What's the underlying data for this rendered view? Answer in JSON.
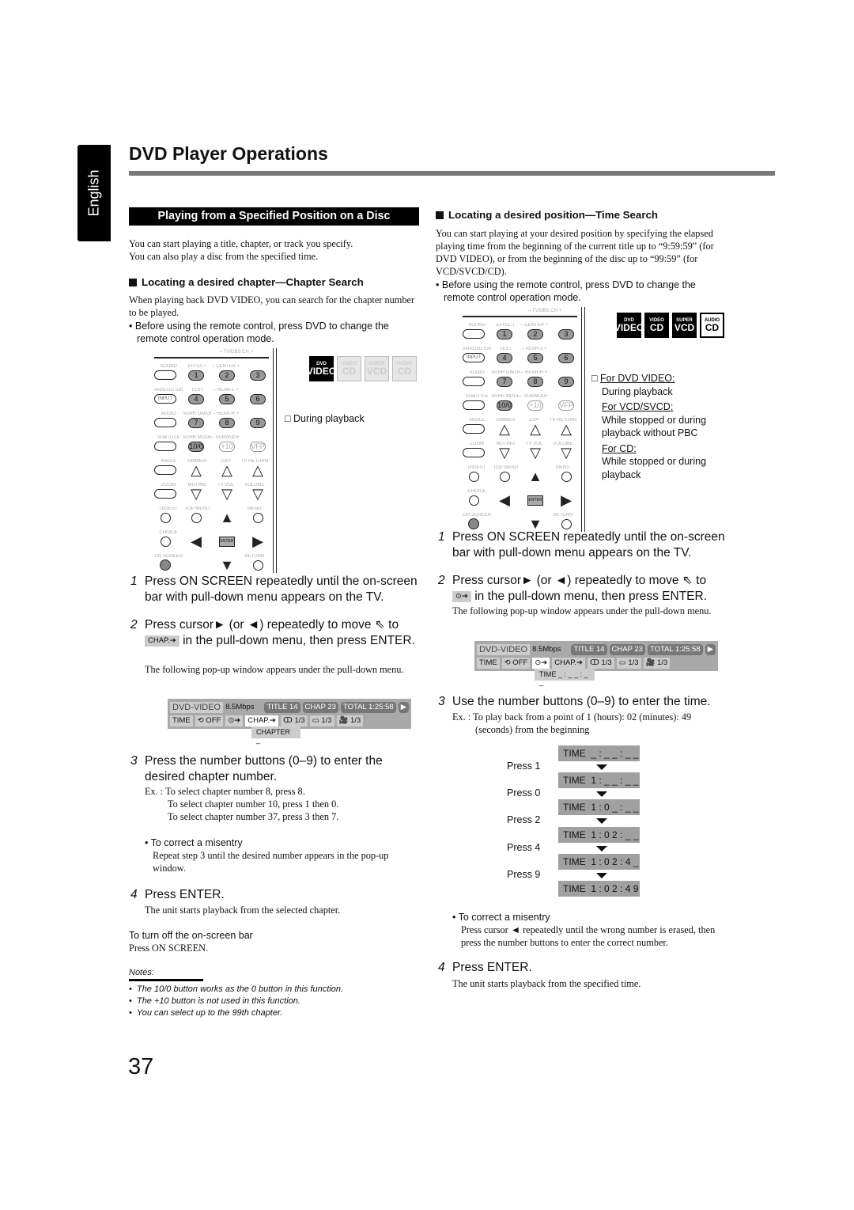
{
  "header": {
    "title": "DVD Player Operations",
    "language_tab": "English",
    "page_number": "37"
  },
  "left": {
    "banner": "Playing from a Specified Position on a Disc",
    "intro": [
      "You can start playing a title, chapter, or track you specify.",
      "You can also play a disc from the specified time."
    ],
    "heading": "Locating a desired chapter—Chapter Search",
    "para": "When playing back DVD VIDEO, you can search for the chapter number to be played.",
    "bullet": "Before using the remote control, press DVD to change the remote control operation mode.",
    "condition": "□ During playback",
    "step1": "Press ON SCREEN repeatedly until the on-screen bar with pull-down menu appears on the TV.",
    "step2_pre": "Press cursor► (or ◄) repeatedly to move",
    "step2_to": "to",
    "step2_icon": "CHAP.➔",
    "step2_post": "in the pull-down menu, then press ENTER.",
    "step2_note": "The following pop-up window appears under the pull-down menu.",
    "popup": "CHAPTER  _",
    "step3": "Press the number buttons (0–9) to enter the desired chapter number.",
    "examples": [
      "Ex. : To select chapter number 8, press 8.",
      "To select chapter number 10, press 1 then 0.",
      "To select chapter number 37, press 3 then 7."
    ],
    "misentry": "To correct a misentry",
    "misentry_text": "Repeat step 3 until the desired number appears in the pop-up window.",
    "step4": "Press ENTER.",
    "step4_note": "The unit starts playback from the selected chapter.",
    "turnoff_title": "To turn off the on-screen bar",
    "turnoff_text": "Press ON SCREEN.",
    "notes_title": "Notes:",
    "notes": [
      "The 10/0 button works as the 0 button in this function.",
      "The +10 button is not used in this function.",
      "You can select up to the 99th chapter."
    ]
  },
  "right": {
    "heading": "Locating a desired position—Time Search",
    "para": "You can start playing at your desired position by specifying the elapsed playing time from the beginning of the current title up to “9:59:59” (for DVD VIDEO), or from the beginning of the disc up to “99:59” (for VCD/SVCD/CD).",
    "bullet": "Before using the remote control, press DVD to change the remote control operation mode.",
    "conditions": [
      {
        "label": "For DVD VIDEO:",
        "text": "During playback"
      },
      {
        "label": "For VCD/SVCD:",
        "text": "While stopped or during playback without PBC"
      },
      {
        "label": "For CD:",
        "text": "While stopped or during playback"
      }
    ],
    "step1": "Press ON SCREEN repeatedly until the on-screen bar with pull-down menu appears on the TV.",
    "step2_pre": "Press cursor► (or ◄) repeatedly to move",
    "step2_to": "to",
    "step2_icon": "⊙➔",
    "step2_post": "in the pull-down menu, then press ENTER.",
    "step2_note": "The following pop-up window appears under the pull-down menu.",
    "popup": "TIME  _ : _ _ : _ _",
    "step3": "Use the number buttons (0–9) to enter the time.",
    "example": "Ex. : To play back from a point of 1 (hours): 02 (minutes): 49 (seconds) from the beginning",
    "sequence": {
      "presses": [
        "Press 1",
        "Press 0",
        "Press 2",
        "Press 4",
        "Press 9"
      ],
      "displays": [
        "TIME  _ : _ _ : _ _",
        "TIME  1 : _ _ : _ _",
        "TIME  1 : 0 _ : _ _",
        "TIME  1 : 0 2 : _ _",
        "TIME  1 : 0 2 : 4 _",
        "TIME  1 : 0 2 : 4 9"
      ]
    },
    "misentry": "To correct a misentry",
    "misentry_text": "Press cursor ◄ repeatedly until the wrong number is erased, then press the number buttons to enter the correct number.",
    "step4": "Press ENTER.",
    "step4_note": "The unit starts playback from the specified time."
  },
  "osd": {
    "disc": "DVD-VIDEO",
    "rate": "8.5Mbps",
    "title": "TITLE 14",
    "chap": "CHAP 23",
    "total": "TOTAL 1:25:58",
    "play": "▶",
    "time": "TIME",
    "repeat": "⟲ OFF",
    "time_search": "⊙➔",
    "chap_search": "CHAP.➔",
    "audio": "ↀ 1/3",
    "subtitle": "▭ 1/3",
    "angle": "🎥 1/3"
  },
  "discs": [
    {
      "small": "DVD",
      "big": "VIDEO"
    },
    {
      "small": "VIDEO",
      "big": "CD"
    },
    {
      "small": "SUPER",
      "big": "VCD"
    },
    {
      "small": "AUDIO",
      "big": "CD"
    }
  ],
  "remote": {
    "top": "– TV/DBS CH +",
    "rows": [
      {
        "labels": [
          "SOUND",
          "EFFECT",
          "– CENTER +",
          ""
        ],
        "buttons": [
          [
            "oval",
            ""
          ],
          [
            "num",
            "1"
          ],
          [
            "num",
            "2"
          ],
          [
            "num",
            "3"
          ]
        ]
      },
      {
        "labels": [
          "ANALOG /DIGITAL",
          "TEST",
          "– REAR-L +",
          ""
        ],
        "buttons": [
          [
            "oval",
            "INPUT"
          ],
          [
            "num",
            "4"
          ],
          [
            "num",
            "5"
          ],
          [
            "num",
            "6"
          ]
        ]
      },
      {
        "labels": [
          "AUDIO",
          "SURR ON/OFF",
          "– REAR-R +",
          ""
        ],
        "buttons": [
          [
            "oval",
            ""
          ],
          [
            "num",
            "7"
          ],
          [
            "num",
            "8"
          ],
          [
            "num",
            "9"
          ]
        ]
      },
      {
        "labels": [
          "SUBTITLE",
          "SURR MODE",
          "– SUBWOOFER +",
          ""
        ],
        "buttons": [
          [
            "oval",
            ""
          ],
          [
            "num",
            "10/0"
          ],
          [
            "light",
            "+10"
          ],
          [
            "light",
            "VFP"
          ]
        ]
      },
      {
        "labels": [
          "ANGLE",
          "DIMMER",
          "100+",
          "TV RETURN"
        ],
        "buttons": [
          [
            "oval",
            ""
          ],
          [
            "tri",
            "△"
          ],
          [
            "tri",
            "△"
          ],
          [
            "tri",
            "△"
          ]
        ]
      },
      {
        "labels": [
          "ZOOM",
          "MUTING",
          "TV VOL",
          "VOLUME"
        ],
        "buttons": [
          [
            "oval",
            ""
          ],
          [
            "tri",
            "▽"
          ],
          [
            "tri",
            "▽"
          ],
          [
            "tri",
            "▽"
          ]
        ]
      },
      {
        "labels": [
          "DIGEST",
          "TOP MENU",
          "",
          "MENU"
        ],
        "buttons": [
          [
            "circ",
            ""
          ],
          [
            "circ",
            ""
          ],
          [
            "tri",
            "▲"
          ],
          [
            "circ",
            ""
          ]
        ]
      },
      {
        "labels": [
          "CHOICE",
          "",
          "",
          ""
        ],
        "buttons": [
          [
            "circ",
            ""
          ],
          [
            "tri",
            "◀"
          ],
          [
            "enter",
            "ENTER"
          ],
          [
            "tri",
            "▶"
          ]
        ]
      },
      {
        "labels": [
          "ON SCREEN",
          "",
          "",
          "RETURN"
        ],
        "buttons": [
          [
            "red",
            ""
          ],
          [
            "none",
            ""
          ],
          [
            "tri",
            "▼"
          ],
          [
            "circ",
            ""
          ]
        ]
      }
    ]
  },
  "colors": {
    "title_bar": "#777777",
    "osd_bg": "#a9a9a9",
    "time_box": "#a0a0a0"
  }
}
